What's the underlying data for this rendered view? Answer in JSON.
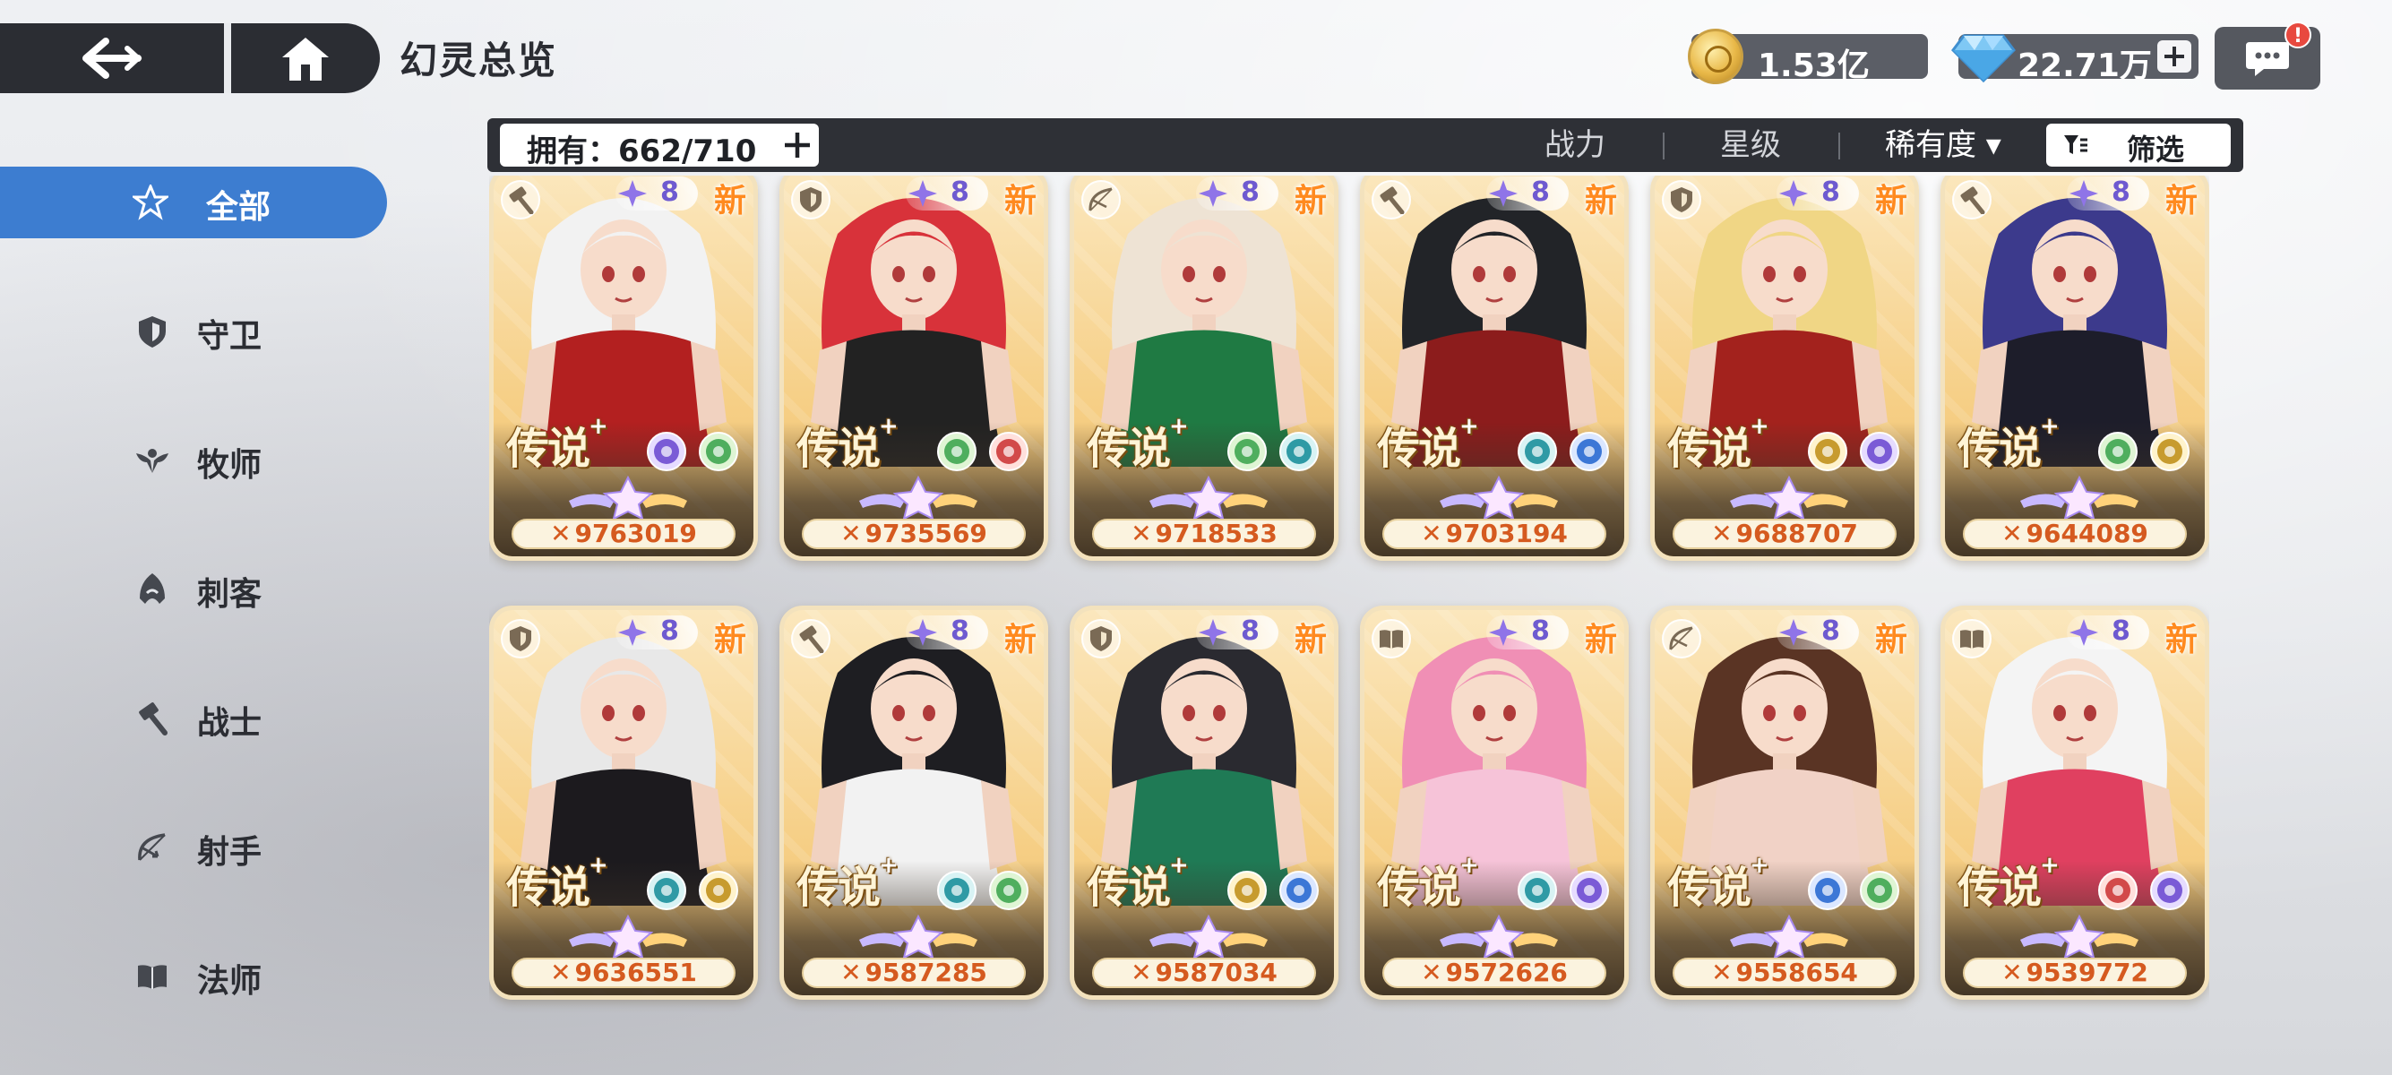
{
  "header": {
    "title": "幻灵总览",
    "gold": "1.53亿",
    "gems": "22.71万",
    "chat_badge": "!"
  },
  "filter": {
    "owned": "拥有：662/710",
    "sort_power": "战力",
    "sort_star": "星级",
    "sort_rarity": "稀有度 ▾",
    "filter_label": "筛选"
  },
  "sidebar": {
    "items": [
      {
        "label": "全部",
        "icon": "all-classes-icon"
      },
      {
        "label": "守卫",
        "icon": "shield-icon"
      },
      {
        "label": "牧师",
        "icon": "priest-wings-icon"
      },
      {
        "label": "刺客",
        "icon": "assassin-hood-icon"
      },
      {
        "label": "战士",
        "icon": "hammer-icon"
      },
      {
        "label": "射手",
        "icon": "bow-icon"
      },
      {
        "label": "法师",
        "icon": "book-icon"
      }
    ]
  },
  "colors": {
    "accent_blue": "#3d7dd0",
    "dark_bar": "#2e3036",
    "power_orange": "#d55a1f",
    "card_gold": "#f6cf86",
    "new_orange": "#ff8a1f"
  },
  "cards": [
    {
      "power": "9763019",
      "level": "8",
      "rarity": "传说",
      "new": "新",
      "class_icon": "hammer-icon",
      "elements": [
        "purple",
        "green"
      ],
      "hair": "#f2f2f2",
      "outfit": "#b32020"
    },
    {
      "power": "9735569",
      "level": "8",
      "rarity": "传说",
      "new": "新",
      "class_icon": "shield-icon",
      "elements": [
        "green",
        "red"
      ],
      "hair": "#d8323a",
      "outfit": "#222222"
    },
    {
      "power": "9718533",
      "level": "8",
      "rarity": "传说",
      "new": "新",
      "class_icon": "bow-icon",
      "elements": [
        "green",
        "teal"
      ],
      "hair": "#eee3d4",
      "outfit": "#1f7a43"
    },
    {
      "power": "9703194",
      "level": "8",
      "rarity": "传说",
      "new": "新",
      "class_icon": "hammer-icon",
      "elements": [
        "teal",
        "blue"
      ],
      "hair": "#222428",
      "outfit": "#8c1c1c"
    },
    {
      "power": "9688707",
      "level": "8",
      "rarity": "传说",
      "new": "新",
      "class_icon": "shield-icon",
      "elements": [
        "gold",
        "purple"
      ],
      "hair": "#f0d685",
      "outfit": "#a3221d"
    },
    {
      "power": "9644089",
      "level": "8",
      "rarity": "传说",
      "new": "新",
      "class_icon": "hammer-icon",
      "elements": [
        "green",
        "gold"
      ],
      "hair": "#3c3a8c",
      "outfit": "#1d1d2a"
    },
    {
      "power": "9636551",
      "level": "8",
      "rarity": "传说",
      "new": "新",
      "class_icon": "shield-icon",
      "elements": [
        "teal",
        "gold"
      ],
      "hair": "#e8e8e8",
      "outfit": "#1c1a1e"
    },
    {
      "power": "9587285",
      "level": "8",
      "rarity": "传说",
      "new": "新",
      "class_icon": "hammer-icon",
      "elements": [
        "teal",
        "green"
      ],
      "hair": "#1e1e22",
      "outfit": "#f2f2f2"
    },
    {
      "power": "9587034",
      "level": "8",
      "rarity": "传说",
      "new": "新",
      "class_icon": "shield-icon",
      "elements": [
        "gold",
        "blue"
      ],
      "hair": "#2a2a30",
      "outfit": "#1f7a55"
    },
    {
      "power": "9572626",
      "level": "8",
      "rarity": "传说",
      "new": "新",
      "class_icon": "book-icon",
      "elements": [
        "teal",
        "purple"
      ],
      "hair": "#f08fb5",
      "outfit": "#f6c3d8"
    },
    {
      "power": "9558654",
      "level": "8",
      "rarity": "传说",
      "new": "新",
      "class_icon": "bow-icon",
      "elements": [
        "blue",
        "green"
      ],
      "hair": "#5a3424",
      "outfit": "#f1d2c6"
    },
    {
      "power": "9539772",
      "level": "8",
      "rarity": "传说",
      "new": "新",
      "class_icon": "book-icon",
      "elements": [
        "red",
        "purple"
      ],
      "hair": "#f4f4f4",
      "outfit": "#e04060"
    }
  ]
}
